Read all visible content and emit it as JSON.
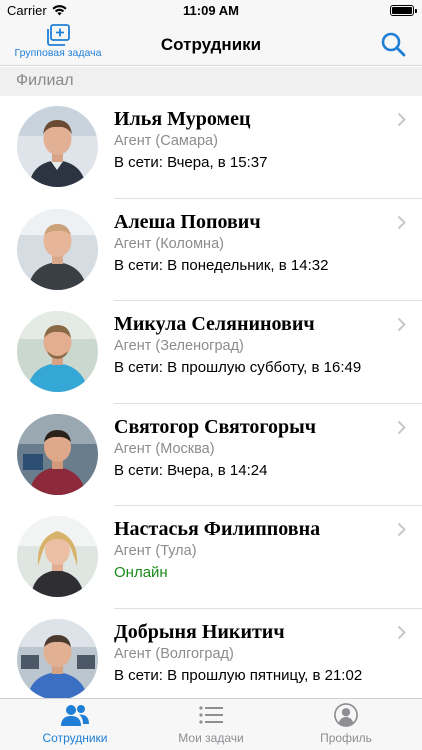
{
  "status_bar": {
    "carrier": "Carrier",
    "time": "11:09 AM"
  },
  "nav": {
    "title": "Сотрудники",
    "group_task_label": "Групповая задача",
    "accent_color": "#1f7fd6"
  },
  "section": {
    "title": "Филиал"
  },
  "employees": [
    {
      "name": "Илья Муромец",
      "role": "Агент (Самара)",
      "status": "В сети: Вчера, в 15:37",
      "online": false
    },
    {
      "name": "Алеша Попович",
      "role": "Агент (Коломна)",
      "status": "В сети: В понедельник, в 14:32",
      "online": false
    },
    {
      "name": "Микула Селянинович",
      "role": "Агент (Зеленоград)",
      "status": "В сети: В прошлую субботу, в 16:49",
      "online": false
    },
    {
      "name": "Святогор Святогорыч",
      "role": "Агент (Москва)",
      "status": "В сети: Вчера, в 14:24",
      "online": false
    },
    {
      "name": "Настасья Филипповна",
      "role": "Агент (Тула)",
      "status": "Онлайн",
      "online": true
    },
    {
      "name": "Добрыня Никитич",
      "role": "Агент (Волгоград)",
      "status": "В сети: В прошлую пятницу, в 21:02",
      "online": false
    }
  ],
  "tabs": [
    {
      "label": "Сотрудники",
      "icon": "people-icon",
      "active": true
    },
    {
      "label": "Мои задачи",
      "icon": "list-icon",
      "active": false
    },
    {
      "label": "Профиль",
      "icon": "profile-icon",
      "active": false
    }
  ],
  "colors": {
    "online": "#1a8c1a",
    "secondary_text": "#8c8c8c",
    "section_bg": "#f0f0f0"
  }
}
